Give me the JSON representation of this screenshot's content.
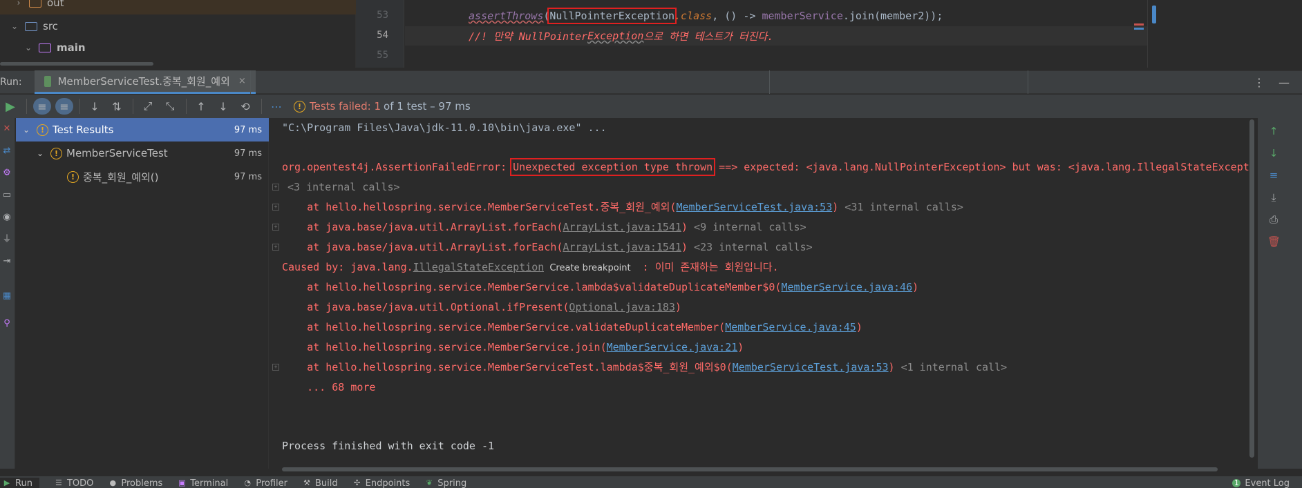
{
  "project": {
    "out_label": "out",
    "src_label": "src",
    "main_label": "main"
  },
  "editor": {
    "line_53": "53",
    "line_54": "54",
    "line_55": "55",
    "code_53": {
      "fn": "assertThrows",
      "paren": "(",
      "exc": "NullPointerException",
      "cls": ".class",
      "rest": ", () -> ",
      "svc": "memberService",
      "call": ".join(member2));"
    },
    "code_54": {
      "prefix": "//! 만약 NullPointer",
      "under": "Exception",
      "suffix": "으로 하면 테스트가 터진다."
    }
  },
  "runbar": {
    "label": "Run:",
    "tab_title": "MemberServiceTest.중복_회원_예외",
    "close": "×"
  },
  "toolbar": {
    "status_failed": "Tests failed: 1",
    "status_rest": "of 1 test – 97 ms",
    "more": "⋯"
  },
  "tree": {
    "root_label": "Test Results",
    "root_time": "97 ms",
    "class_label": "MemberServiceTest",
    "class_time": "97 ms",
    "method_label": "중복_회원_예외()",
    "method_time": "97 ms"
  },
  "console": {
    "line1": "\"C:\\Program Files\\Java\\jdk-11.0.10\\bin\\java.exe\" ...",
    "err_prefix": "org.opentest4j.AssertionFailedError: ",
    "err_box": "Unexpected exception type thrown",
    "err_suffix": " ==> expected: <java.lang.NullPointerException> but was: <java.lang.IllegalStateExcept:",
    "internal3": "<3 internal calls>",
    "at1_prefix": "    at hello.hellospring.service.MemberServiceTest.중복_회원_예외(",
    "at1_link": "MemberServiceTest.java:53",
    "at1_suffix": ")",
    "at1_dim": " <31 internal calls>",
    "at2_prefix": "    at java.base/java.util.ArrayList.forEach(",
    "at2_link": "ArrayList.java:1541",
    "at2_suffix": ")",
    "at2_dim": " <9 internal calls>",
    "at3_prefix": "    at java.base/java.util.ArrayList.forEach(",
    "at3_link": "ArrayList.java:1541",
    "at3_suffix": ")",
    "at3_dim": " <23 internal calls>",
    "cause_prefix": "Caused by: java.lang.",
    "cause_link": "IllegalStateException",
    "cause_tooltip": "Create breakpoint",
    "cause_suffix": " : 이미 존재하는 회원입니다.",
    "at4_prefix": "    at hello.hellospring.service.MemberService.lambda$validateDuplicateMember$0(",
    "at4_link": "MemberService.java:46",
    "at4_suffix": ")",
    "at5_prefix": "    at java.base/java.util.Optional.ifPresent(",
    "at5_link": "Optional.java:183",
    "at5_suffix": ")",
    "at6_prefix": "    at hello.hellospring.service.MemberService.validateDuplicateMember(",
    "at6_link": "MemberService.java:45",
    "at6_suffix": ")",
    "at7_prefix": "    at hello.hellospring.service.MemberService.join(",
    "at7_link": "MemberService.java:21",
    "at7_suffix": ")",
    "at8_prefix": "    at hello.hellospring.service.MemberServiceTest.lambda$중복_회원_예외$0(",
    "at8_link": "MemberServiceTest.java:53",
    "at8_suffix": ")",
    "at8_dim": " <1 internal call>",
    "more": "    ... 68 more",
    "exit": "Process finished with exit code -1"
  },
  "bottom": {
    "run": "Run",
    "todo": "TODO",
    "problems": "Problems",
    "terminal": "Terminal",
    "profiler": "Profiler",
    "build": "Build",
    "endpoints": "Endpoints",
    "spring": "Spring",
    "event_log": "Event Log",
    "event_count": "1"
  },
  "colors": {
    "accent": "#4b6eaf",
    "error": "#ff6b68",
    "warning": "#e5a822",
    "link": "#5c9fd8"
  }
}
